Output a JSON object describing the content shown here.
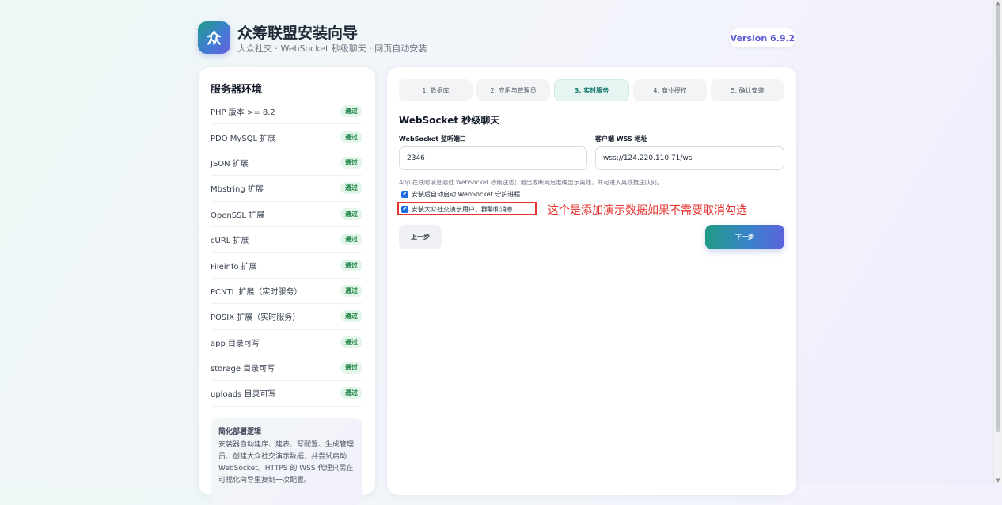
{
  "header": {
    "logo_char": "众",
    "title": "众筹联盟安装向导",
    "subtitle": "大众社交 · WebSocket 秒级聊天 · 网页自动安装",
    "version": "Version 6.9.2"
  },
  "env": {
    "title": "服务器环境",
    "items": [
      {
        "label": "PHP 版本 >= 8.2",
        "status": "通过"
      },
      {
        "label": "PDO MySQL 扩展",
        "status": "通过"
      },
      {
        "label": "JSON 扩展",
        "status": "通过"
      },
      {
        "label": "Mbstring 扩展",
        "status": "通过"
      },
      {
        "label": "OpenSSL 扩展",
        "status": "通过"
      },
      {
        "label": "cURL 扩展",
        "status": "通过"
      },
      {
        "label": "Fileinfo 扩展",
        "status": "通过"
      },
      {
        "label": "PCNTL 扩展（实时服务）",
        "status": "通过"
      },
      {
        "label": "POSIX 扩展（实时服务）",
        "status": "通过"
      },
      {
        "label": "app 目录可写",
        "status": "通过"
      },
      {
        "label": "storage 目录可写",
        "status": "通过"
      },
      {
        "label": "uploads 目录可写",
        "status": "通过"
      }
    ],
    "note_title": "简化部署逻辑",
    "note_body": "安装器自动建库、建表、写配置、生成管理员、创建大众社交演示数据，并尝试启动 WebSocket。HTTPS 的 WSS 代理只需在可视化向导里复制一次配置。"
  },
  "steps": [
    {
      "label": "1. 数据库",
      "active": false
    },
    {
      "label": "2. 应用与管理员",
      "active": false
    },
    {
      "label": "3. 实时服务",
      "active": true
    },
    {
      "label": "4. 商业授权",
      "active": false
    },
    {
      "label": "5. 确认安装",
      "active": false
    }
  ],
  "form": {
    "section_title": "WebSocket 秒级聊天",
    "port_label": "WebSocket 监听端口",
    "port_value": "2346",
    "wss_label": "客户端 WSS 地址",
    "wss_value": "wss://124.220.110.71/ws",
    "help": "App 在线时消息通过 WebSocket 秒级送达；退出或断网后准确显示离线，并可进入离线推送队列。",
    "check_daemon": "安装后自动启动 WebSocket 守护进程",
    "check_demo": "安装大众社交演示用户、群聊和消息",
    "annotation": "这个是添加演示数据如果不需要取消勾选",
    "prev_label": "上一步",
    "next_label": "下一步"
  }
}
